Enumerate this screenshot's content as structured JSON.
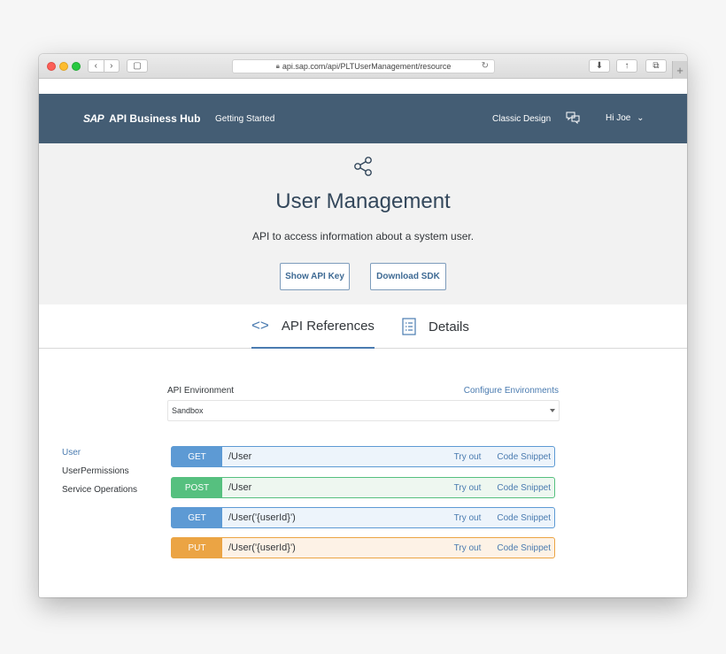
{
  "browser": {
    "url": "api.sap.com/api/PLTUserManagement/resource"
  },
  "header": {
    "brand_sap": "SAP",
    "brand_name": "API Business Hub",
    "getting_started": "Getting Started",
    "classic_design": "Classic Design",
    "user_greeting": "Hi Joe"
  },
  "hero": {
    "title": "User Management",
    "subtitle": "API to access information about a system user.",
    "show_api_key": "Show API Key",
    "download_sdk": "Download SDK"
  },
  "tabs": [
    {
      "label": "API References",
      "active": true
    },
    {
      "label": "Details",
      "active": false
    }
  ],
  "environment": {
    "label": "API Environment",
    "configure_link": "Configure Environments",
    "selected": "Sandbox"
  },
  "sidenav": [
    "User",
    "UserPermissions",
    "Service Operations"
  ],
  "operations": [
    {
      "method": "GET",
      "path": "/User",
      "try_out": "Try out",
      "code_snippet": "Code Snippet"
    },
    {
      "method": "POST",
      "path": "/User",
      "try_out": "Try out",
      "code_snippet": "Code Snippet"
    },
    {
      "method": "GET",
      "path": "/User('{userId}')",
      "try_out": "Try out",
      "code_snippet": "Code Snippet"
    },
    {
      "method": "PUT",
      "path": "/User('{userId}')",
      "try_out": "Try out",
      "code_snippet": "Code Snippet"
    }
  ],
  "colors": {
    "header_bg": "#445d74",
    "accent": "#4a7bb0",
    "get": "#5d9ad4",
    "post": "#56c07f",
    "put": "#eba444"
  }
}
